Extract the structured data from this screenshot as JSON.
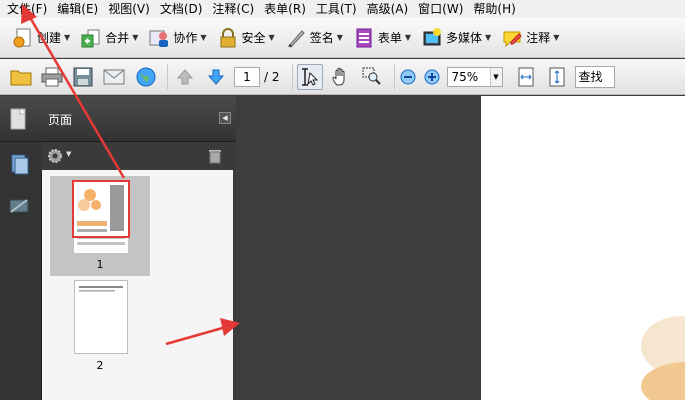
{
  "menu": [
    "文件(F)",
    "编辑(E)",
    "视图(V)",
    "文档(D)",
    "注释(C)",
    "表单(R)",
    "工具(T)",
    "高级(A)",
    "窗口(W)",
    "帮助(H)"
  ],
  "toolbar1": {
    "create": "创建",
    "combine": "合并",
    "collaborate": "协作",
    "secure": "安全",
    "sign": "签名",
    "forms": "表单",
    "multimedia": "多媒体",
    "comment": "注释"
  },
  "toolbar2": {
    "page_current": "1",
    "page_total": "/ 2",
    "zoom": "75%",
    "search_placeholder": "查找"
  },
  "pages_panel": {
    "title": "页面",
    "thumb1_label": "1",
    "thumb2_label": "2"
  },
  "colors": {
    "annotation_red": "#e53935",
    "selection_gray": "#c4c4c4",
    "document_bg": "#3d3d3d"
  }
}
